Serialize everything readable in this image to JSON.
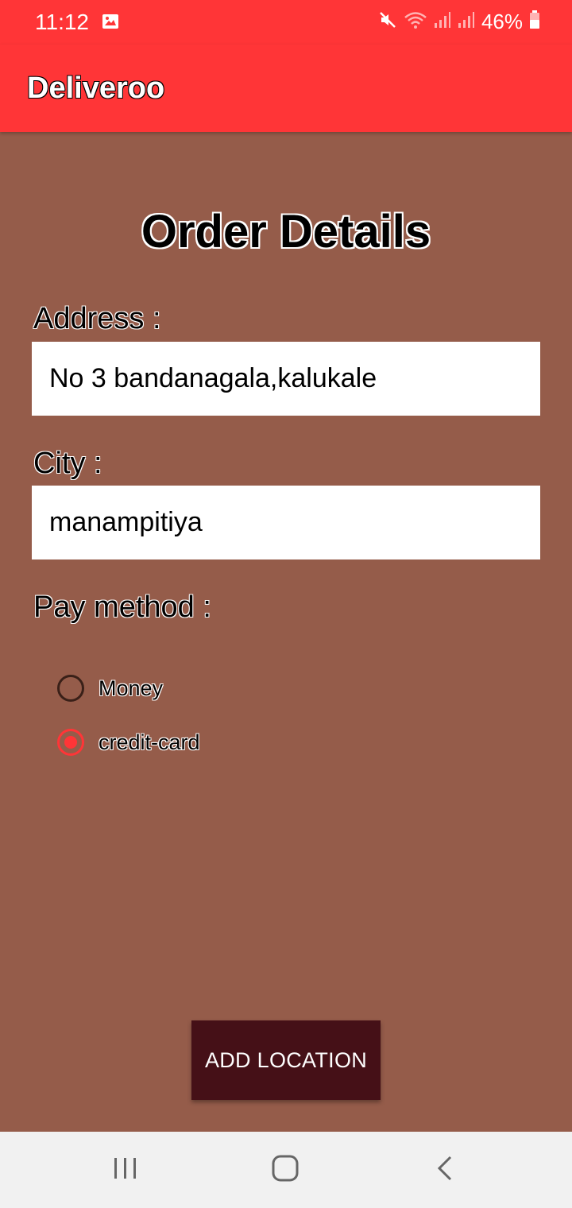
{
  "status_bar": {
    "time": "11:12",
    "battery": "46%",
    "icons": [
      "gallery-icon",
      "mute-icon",
      "wifi-icon",
      "signal-icon",
      "signal-icon",
      "battery-icon"
    ]
  },
  "app_bar": {
    "title": "Deliveroo"
  },
  "form": {
    "title": "Order Details",
    "address_label": "Address :",
    "address_value": "No 3 bandanagala,kalukale",
    "city_label": "City :",
    "city_value": "manampitiya",
    "pay_method_label": "Pay method :",
    "pay_options": [
      {
        "label": "Money",
        "selected": false
      },
      {
        "label": "credit-card",
        "selected": true
      }
    ]
  },
  "actions": {
    "add_location_label": "ADD LOCATION"
  },
  "nav_bar": {
    "icons": [
      "recents-icon",
      "home-icon",
      "back-icon"
    ]
  },
  "colors": {
    "primary": "#ff3537",
    "background": "#955c4a",
    "button": "#451017",
    "nav_bar": "#f1f1f1"
  }
}
